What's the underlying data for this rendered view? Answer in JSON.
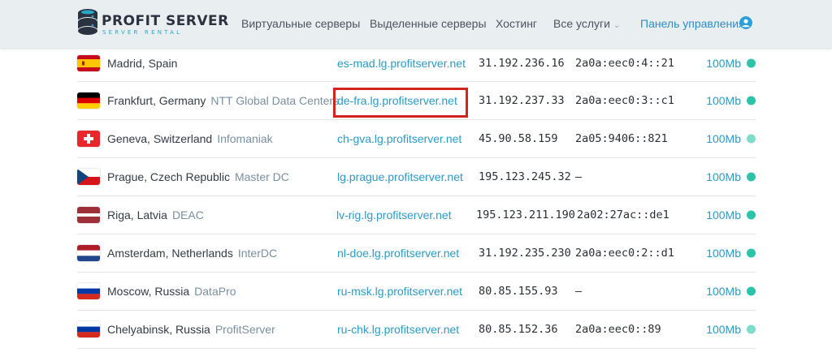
{
  "header": {
    "logo_title": "PROFIT SERVER",
    "logo_subtitle": "SERVER RENTAL",
    "nav": [
      {
        "label": "Виртуальные серверы"
      },
      {
        "label": "Выделенные серверы"
      },
      {
        "label": "Хостинг"
      },
      {
        "label": "Все услуги"
      }
    ],
    "panel_label": "Панель управления"
  },
  "rows": [
    {
      "flag": "spain-flag-icon",
      "city": "Madrid, Spain",
      "provider": "",
      "host": "es-mad.lg.profitserver.net",
      "ipv4": "31.192.236.16",
      "ipv6": "2a0a:eec0:4::21",
      "speed": "100Mb",
      "status_color": "#2bc4a8"
    },
    {
      "flag": "germany-flag-icon",
      "city": "Frankfurt, Germany",
      "provider": "NTT Global Data Centers",
      "host": "de-fra.lg.profitserver.net",
      "ipv4": "31.192.237.33",
      "ipv6": "2a0a:eec0:3::c1",
      "speed": "100Mb",
      "status_color": "#2bc4a8"
    },
    {
      "flag": "switzerland-flag-icon",
      "city": "Geneva, Switzerland",
      "provider": "Infomaniak",
      "host": "ch-gva.lg.profitserver.net",
      "ipv4": "45.90.58.159",
      "ipv6": "2a05:9406::821",
      "speed": "100Mb",
      "status_color": "#7fdcca"
    },
    {
      "flag": "czech-flag-icon",
      "city": "Prague, Czech Republic",
      "provider": "Master DC",
      "host": "lg.prague.profitserver.net",
      "ipv4": "195.123.245.32",
      "ipv6": "–",
      "speed": "100Mb",
      "status_color": "#2bc4a8"
    },
    {
      "flag": "latvia-flag-icon",
      "city": "Riga, Latvia",
      "provider": "DEAC",
      "host": "lv-rig.lg.profitserver.net",
      "ipv4": "195.123.211.190",
      "ipv6": "2a02:27ac::de1",
      "speed": "100Mb",
      "status_color": "#2bc4a8"
    },
    {
      "flag": "netherlands-flag-icon",
      "city": "Amsterdam, Netherlands",
      "provider": "InterDC",
      "host": "nl-doe.lg.profitserver.net",
      "ipv4": "31.192.235.230",
      "ipv6": "2a0a:eec0:2::d1",
      "speed": "100Mb",
      "status_color": "#2bc4a8"
    },
    {
      "flag": "russia-flag-icon",
      "city": "Moscow, Russia",
      "provider": "DataPro",
      "host": "ru-msk.lg.profitserver.net",
      "ipv4": "80.85.155.93",
      "ipv6": "–",
      "speed": "100Mb",
      "status_color": "#2bc4a8"
    },
    {
      "flag": "russia-flag-icon",
      "city": "Chelyabinsk, Russia",
      "provider": "ProfitServer",
      "host": "ru-chk.lg.profitserver.net",
      "ipv4": "80.85.152.36",
      "ipv6": "2a0a:eec0::89",
      "speed": "100Mb",
      "status_color": "#7fdcca"
    }
  ],
  "colors": {
    "accent": "#2b9bc7",
    "status": "#2bc4a8",
    "highlight": "#d2231e"
  }
}
